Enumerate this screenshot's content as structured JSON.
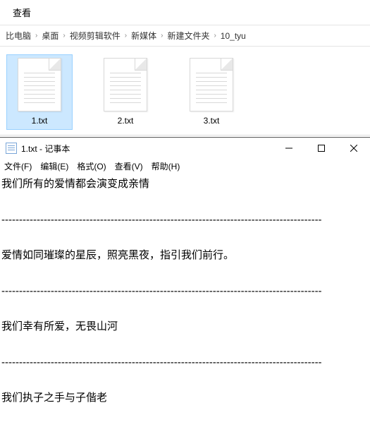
{
  "explorer": {
    "toolbar": {
      "view_label": "查看"
    },
    "breadcrumb": [
      "比电脑",
      "桌面",
      "视频剪辑软件",
      "新媒体",
      "新建文件夹",
      "10_tyu"
    ],
    "files": [
      {
        "name": "1.txt",
        "selected": true
      },
      {
        "name": "2.txt",
        "selected": false
      },
      {
        "name": "3.txt",
        "selected": false
      }
    ]
  },
  "notepad": {
    "title": "1.txt - 记事本",
    "menu": [
      "文件(F)",
      "编辑(E)",
      "格式(O)",
      "查看(V)",
      "帮助(H)"
    ],
    "lines": [
      "我们所有的爱情都会演变成亲情",
      "爱情如同璀璨的星辰，照亮黑夜，指引我们前行。",
      "我们幸有所爱，无畏山河",
      "我们执子之手与子偕老"
    ],
    "dash_row": "-------------------------------------------------------------------------------------------"
  }
}
